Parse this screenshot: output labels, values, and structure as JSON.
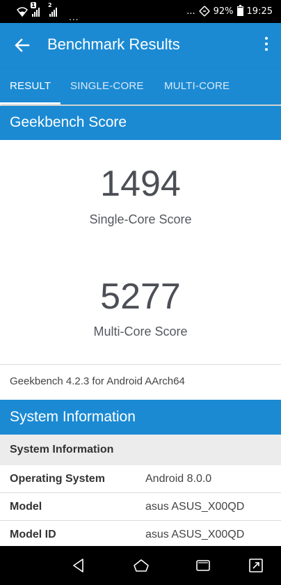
{
  "status_bar": {
    "sim1_label": "1",
    "sim2_label": "2",
    "overflow": "...",
    "overflow_right": "...",
    "battery": "92%",
    "time": "19:25"
  },
  "app_bar": {
    "title": "Benchmark Results"
  },
  "tabs": [
    {
      "label": "RESULT",
      "active": true
    },
    {
      "label": "SINGLE-CORE",
      "active": false
    },
    {
      "label": "MULTI-CORE",
      "active": false
    }
  ],
  "geekbench": {
    "header": "Geekbench Score",
    "single_core_score": "1494",
    "single_core_label": "Single-Core Score",
    "multi_core_score": "5277",
    "multi_core_label": "Multi-Core Score",
    "version": "Geekbench 4.2.3 for Android AArch64"
  },
  "system_info": {
    "header": "System Information",
    "table_header": "System Information",
    "rows": [
      {
        "key": "Operating System",
        "value": "Android 8.0.0"
      },
      {
        "key": "Model",
        "value": "asus ASUS_X00QD"
      },
      {
        "key": "Model ID",
        "value": "asus ASUS_X00QD"
      }
    ]
  },
  "colors": {
    "accent": "#1b8ad3",
    "table_header_bg": "#ececec"
  },
  "icons": [
    "wifi-icon",
    "signal-icon",
    "nfc-icon",
    "battery-icon",
    "back-arrow-icon",
    "more-vert-icon",
    "nav-back-icon",
    "nav-home-icon",
    "nav-recents-icon",
    "screen-rotate-icon"
  ]
}
